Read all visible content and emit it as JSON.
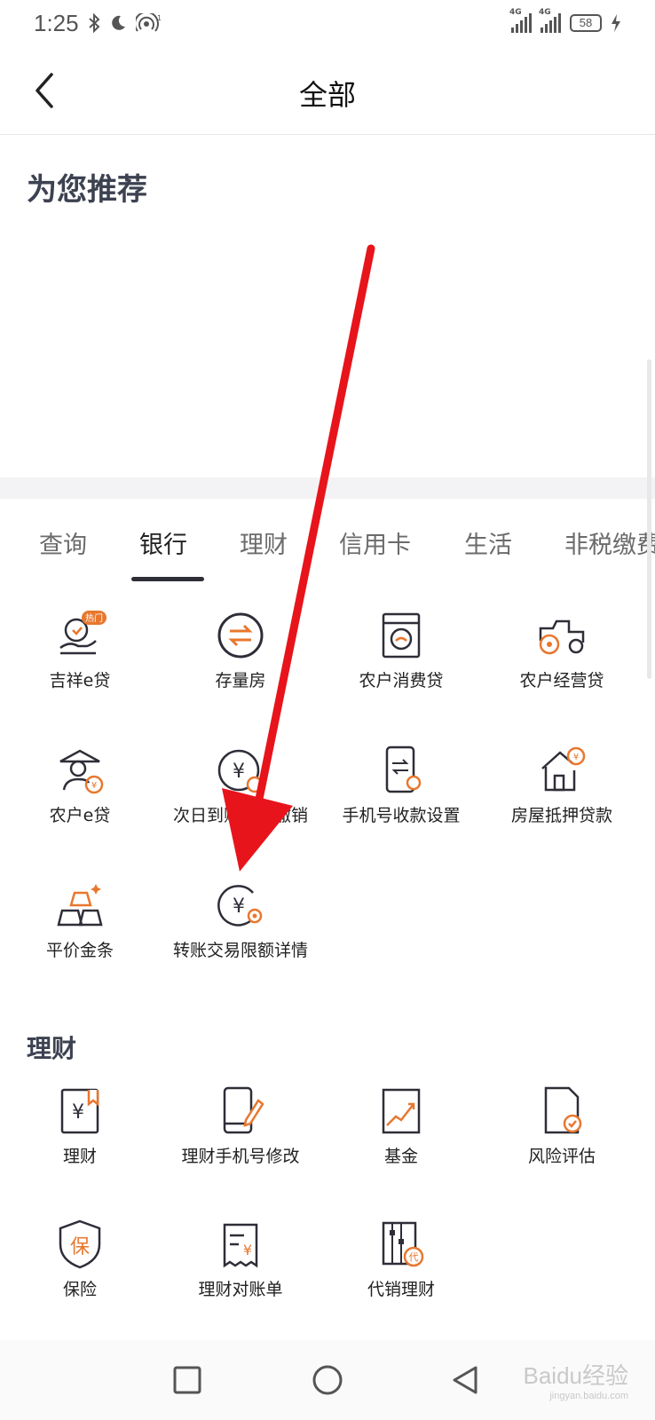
{
  "status_bar": {
    "time": "1:25",
    "battery": "58",
    "network_1": "4G",
    "network_2": "4G"
  },
  "header": {
    "title": "全部"
  },
  "recommend": {
    "title": "为您推荐"
  },
  "tabs": [
    {
      "label": "查询"
    },
    {
      "label": "银行"
    },
    {
      "label": "理财"
    },
    {
      "label": "信用卡"
    },
    {
      "label": "生活"
    },
    {
      "label": "非税缴费"
    }
  ],
  "bank_items": [
    {
      "label": "吉祥e贷",
      "badge": "热门"
    },
    {
      "label": "存量房"
    },
    {
      "label": "农户消费贷"
    },
    {
      "label": "农户经营贷"
    },
    {
      "label": "农户e贷"
    },
    {
      "label": "次日到账交易撤销"
    },
    {
      "label": "手机号收款设置"
    },
    {
      "label": "房屋抵押贷款"
    },
    {
      "label": "平价金条"
    },
    {
      "label": "转账交易限额详情"
    }
  ],
  "finance": {
    "title": "理财",
    "items": [
      {
        "label": "理财"
      },
      {
        "label": "理财手机号修改"
      },
      {
        "label": "基金"
      },
      {
        "label": "风险评估"
      },
      {
        "label": "保险"
      },
      {
        "label": "理财对账单"
      },
      {
        "label": "代销理财"
      }
    ]
  },
  "watermark": {
    "text": "Baidu经验",
    "sub": "jingyan.baidu.com"
  },
  "colors": {
    "accent": "#e8772e",
    "icon_dark": "#2e2e38",
    "annotation": "#e8141b"
  }
}
